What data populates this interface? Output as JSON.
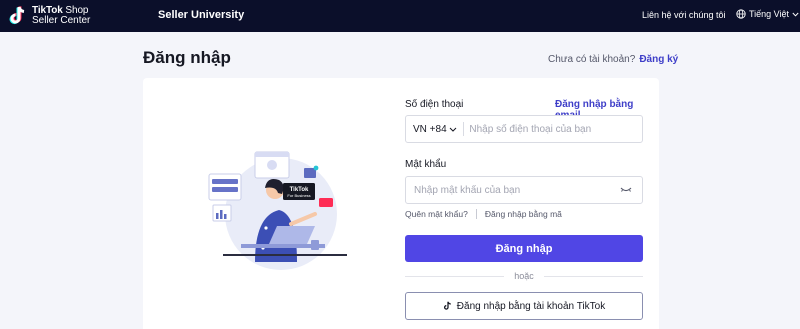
{
  "header": {
    "logo_line1_bold": "TikTok",
    "logo_line1_rest": "Shop",
    "logo_line2": "Seller Center",
    "nav_university": "Seller University",
    "contact": "Liên hệ với chúng tôi",
    "language": "Tiếng Việt"
  },
  "page": {
    "title": "Đăng nhập",
    "no_account": "Chưa có tài khoản?",
    "signup": "Đăng ký"
  },
  "illustration": {
    "badge_line1": "TikTok",
    "badge_line2": "For Business"
  },
  "form": {
    "phone_label": "Số điện thoại",
    "email_login": "Đăng nhập bằng email",
    "country_code": "VN +84",
    "phone_placeholder": "Nhập số điện thoại của bạn",
    "password_label": "Mật khẩu",
    "password_placeholder": "Nhập mật khẩu của bạn",
    "forgot_password": "Quên mật khẩu?",
    "code_login": "Đăng nhập bằng mã",
    "login_button": "Đăng nhập",
    "or_text": "hoặc",
    "tiktok_login": "Đăng nhập bằng tài khoản TikTok"
  },
  "colors": {
    "topbar": "#0b0f2a",
    "accent": "#5046e5",
    "link": "#3e3ec8",
    "background": "#f4f5fa"
  }
}
